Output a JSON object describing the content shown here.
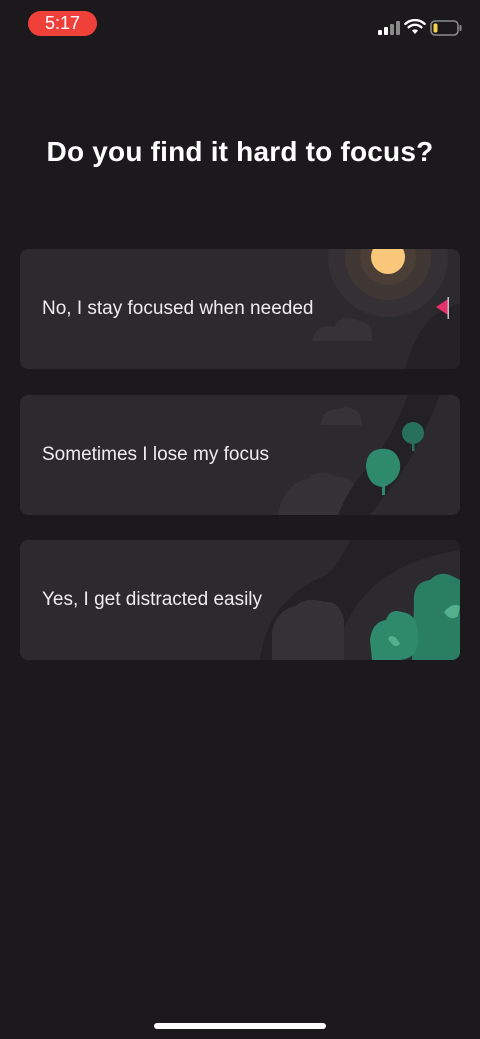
{
  "status_bar": {
    "time": "5:17"
  },
  "title": "Do you find it hard to focus?",
  "options": [
    {
      "label": "No, I stay focused when needed"
    },
    {
      "label": "Sometimes I lose my focus"
    },
    {
      "label": "Yes, I get distracted easily"
    }
  ],
  "icons": {
    "signal": "cellular-signal-icon",
    "wifi": "wifi-icon",
    "battery": "battery-icon"
  },
  "colors": {
    "background": "#1b191c",
    "card": "#2c2a2d",
    "time_pill": "#f0403a",
    "sun": "#f8c779",
    "tree": "#2e8a6b",
    "flag": "#e3336a"
  }
}
